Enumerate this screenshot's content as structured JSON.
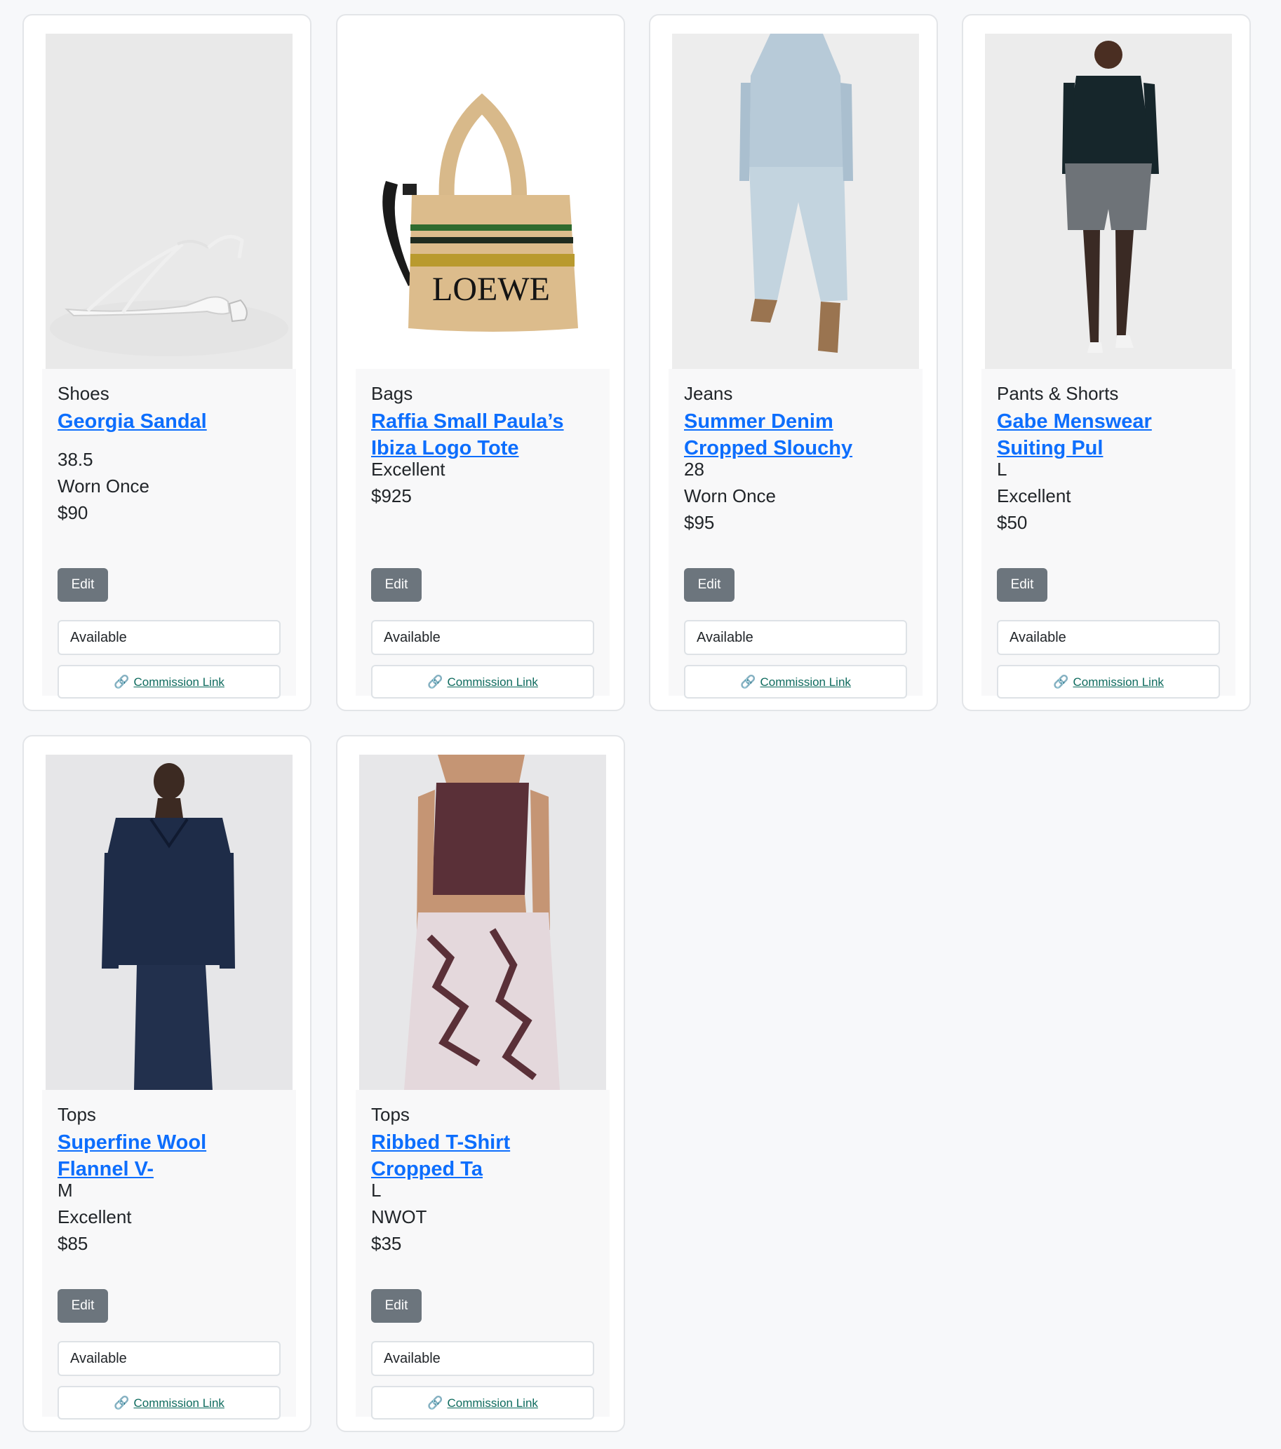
{
  "products": [
    {
      "category": "Shoes",
      "title": "Georgia Sandal",
      "size": "38.5",
      "condition": "Worn Once",
      "price": "$90",
      "edit_label": "Edit",
      "status": "Available",
      "commission_label": "Commission Link",
      "image": "white-sandal-photo"
    },
    {
      "category": "Bags",
      "title": "Raffia Small Paula’s Ibiza Logo Tote",
      "condition": "Excellent",
      "price": "$925",
      "edit_label": "Edit",
      "status": "Available",
      "commission_label": "Commission Link",
      "image": "raffia-tote-bag-photo",
      "image_text": "LOEWE"
    },
    {
      "category": "Jeans",
      "title": "Summer Denim Cropped Slouchy",
      "size": "28",
      "condition": "Worn Once",
      "price": "$95",
      "edit_label": "Edit",
      "status": "Available",
      "commission_label": "Commission Link",
      "image": "denim-outfit-photo"
    },
    {
      "category": "Pants & Shorts",
      "title": "Gabe Menswear Suiting Pul",
      "size": "L",
      "condition": "Excellent",
      "price": "$50",
      "edit_label": "Edit",
      "status": "Available",
      "commission_label": "Commission Link",
      "image": "plaid-shorts-photo"
    },
    {
      "category": "Tops",
      "title": "Superfine Wool Flannel V-",
      "size": "M",
      "condition": "Excellent",
      "price": "$85",
      "edit_label": "Edit",
      "status": "Available",
      "commission_label": "Commission Link",
      "image": "navy-wool-top-photo"
    },
    {
      "category": "Tops",
      "title": "Ribbed T-Shirt Cropped Ta",
      "size": "L",
      "condition": "NWOT",
      "price": "$35",
      "edit_label": "Edit",
      "status": "Available",
      "commission_label": "Commission Link",
      "image": "ribbed-tank-photo"
    }
  ],
  "colors": {
    "link": "#0d6efd",
    "edit_button": "#6c757d",
    "commission_link": "#0e6b5e",
    "page_background": "#f7f8fa"
  }
}
